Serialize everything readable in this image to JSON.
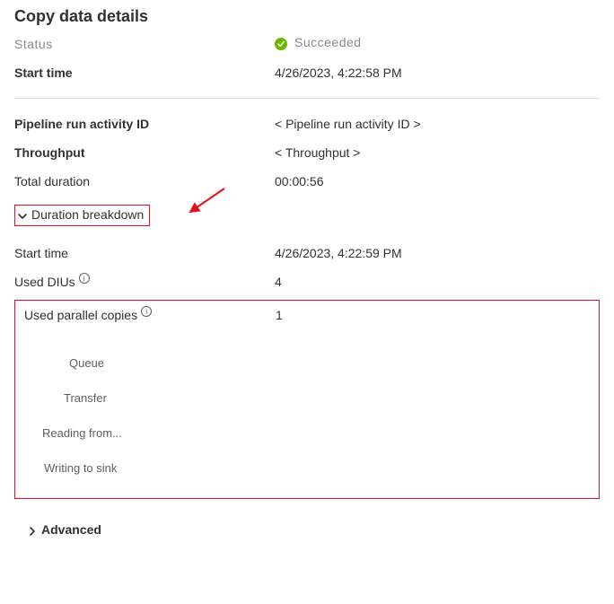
{
  "title": "Copy data details",
  "status": {
    "label_partial": "Status",
    "value_partial": "Succeeded"
  },
  "start_time": {
    "label": "Start time",
    "value": "4/26/2023, 4:22:58 PM"
  },
  "pipeline_id": {
    "label": "Pipeline run activity ID",
    "value": "< Pipeline run activity ID >"
  },
  "throughput": {
    "label": "Throughput",
    "value": "< Throughput >"
  },
  "total_duration": {
    "label": "Total duration",
    "value": "00:00:56"
  },
  "duration_breakdown": {
    "label": "Duration breakdown"
  },
  "breakdown_start": {
    "label": "Start time",
    "value": "4/26/2023, 4:22:59 PM"
  },
  "used_dius": {
    "label": "Used DIUs",
    "value": "4"
  },
  "used_parallel": {
    "label": "Used parallel copies",
    "value": "1"
  },
  "phases": {
    "queue": "Queue",
    "transfer": "Transfer",
    "reading": "Reading from...",
    "writing": "Writing to sink"
  },
  "advanced": {
    "label": "Advanced"
  },
  "annotation_color": "#e31021"
}
